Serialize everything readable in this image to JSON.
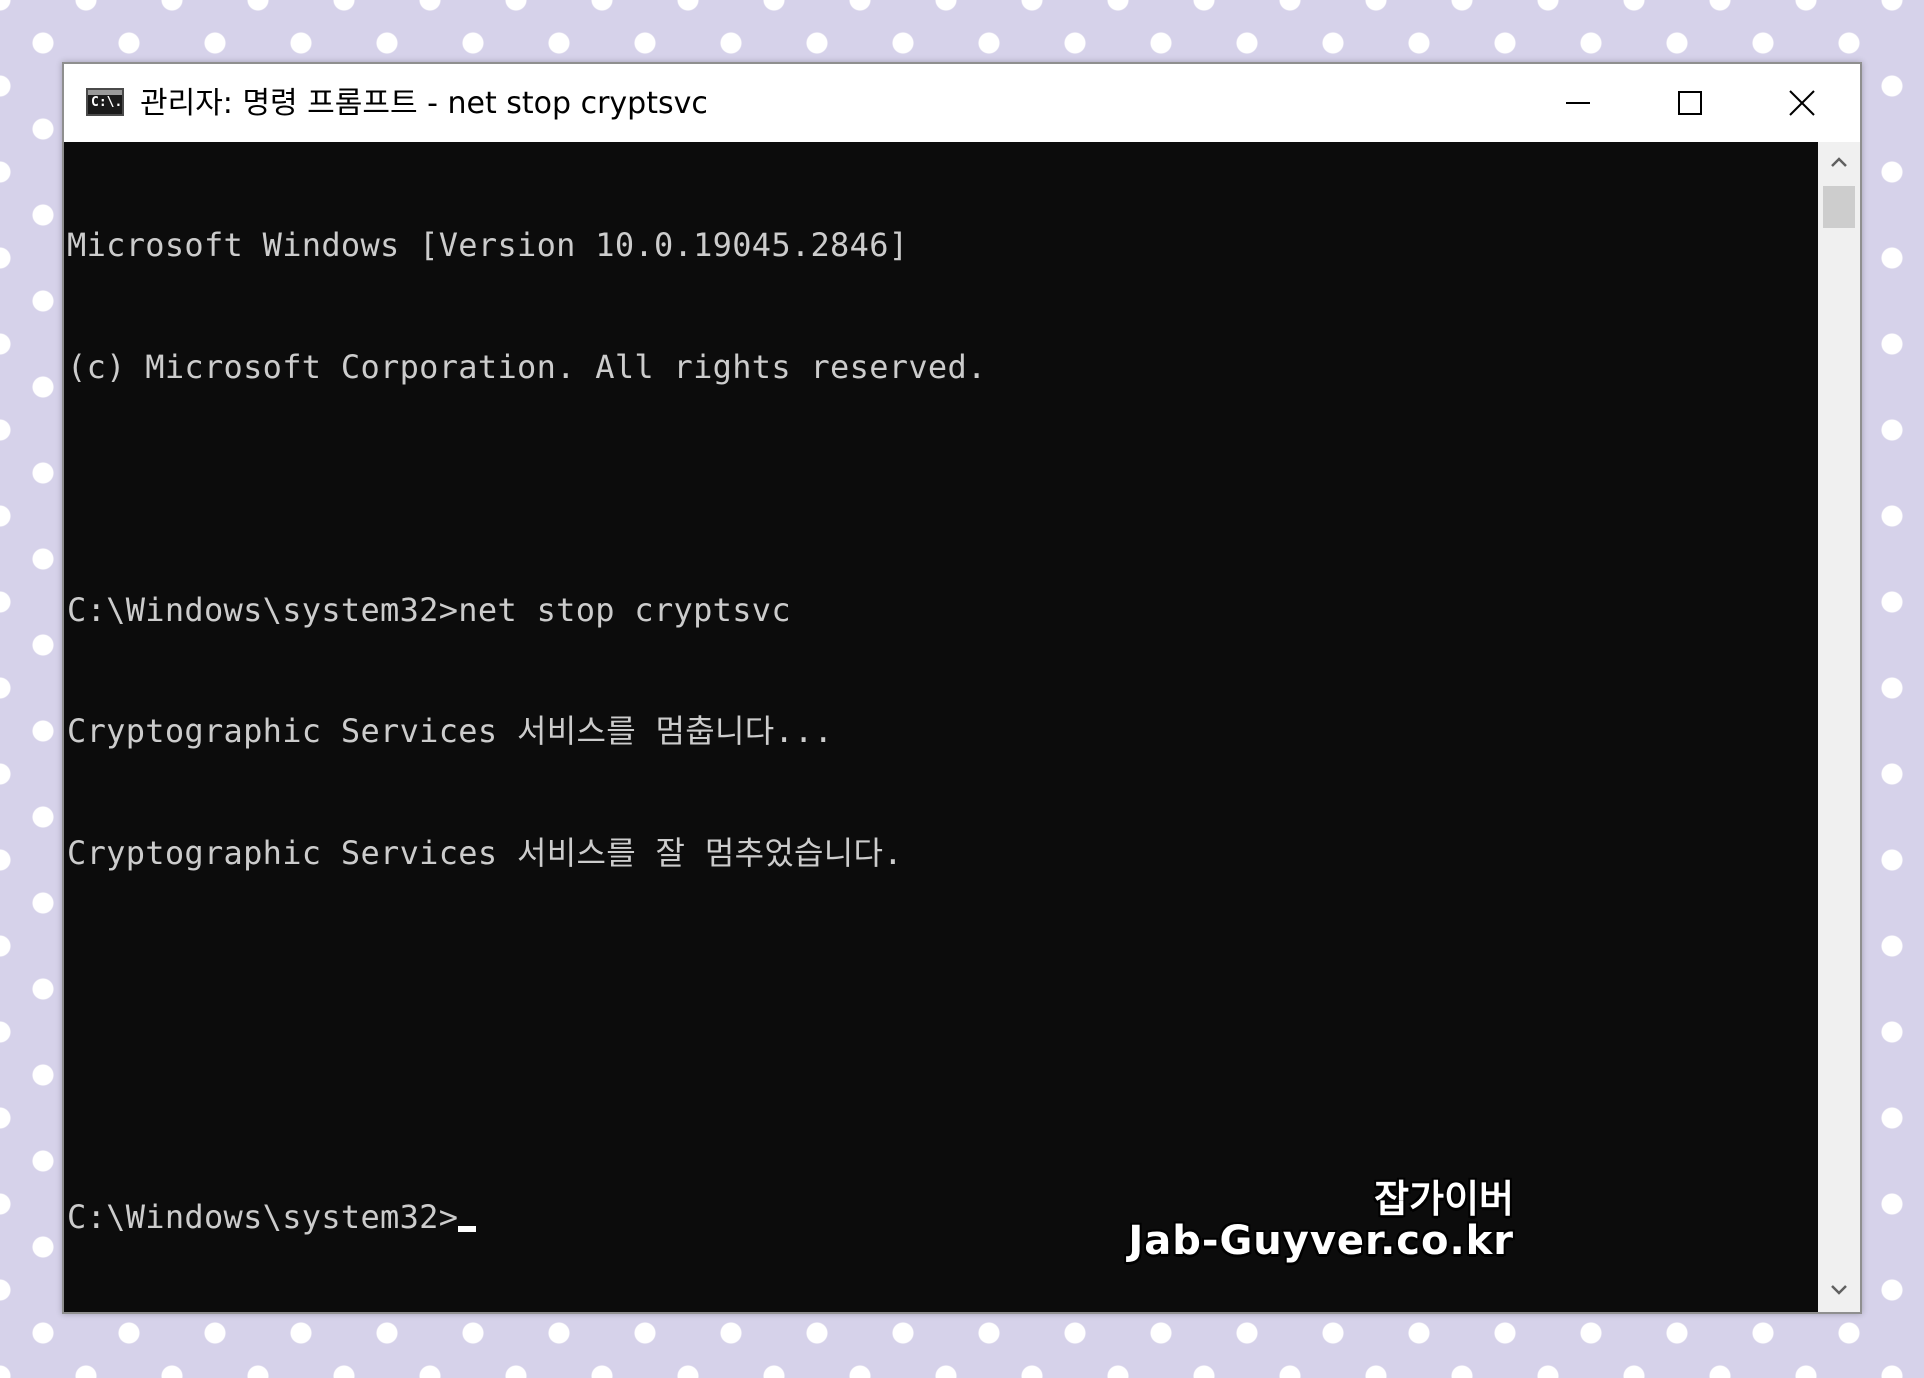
{
  "window": {
    "title": "관리자: 명령 프롬프트 - net  stop cryptsvc",
    "icon": "cmd-icon",
    "icon_text": "C:\\.",
    "controls": {
      "minimize": "minimize-icon",
      "maximize": "maximize-icon",
      "close": "close-icon"
    }
  },
  "console": {
    "lines": [
      "Microsoft Windows [Version 10.0.19045.2846]",
      "(c) Microsoft Corporation. All rights reserved.",
      "",
      "C:\\Windows\\system32>net stop cryptsvc",
      "Cryptographic Services 서비스를 멈춥니다...",
      "Cryptographic Services 서비스를 잘 멈추었습니다.",
      "",
      "",
      "C:\\Windows\\system32>"
    ],
    "background": "#0c0c0c",
    "foreground": "#cccccc"
  },
  "scrollbar": {
    "up": "chevron-up-icon",
    "down": "chevron-down-icon"
  },
  "watermark": {
    "korean": "잡가이버",
    "url": "Jab-Guyver.co.kr"
  },
  "colors": {
    "page_background": "#d6d2ea",
    "polka_dot": "#ffffff",
    "titlebar": "#ffffff"
  }
}
